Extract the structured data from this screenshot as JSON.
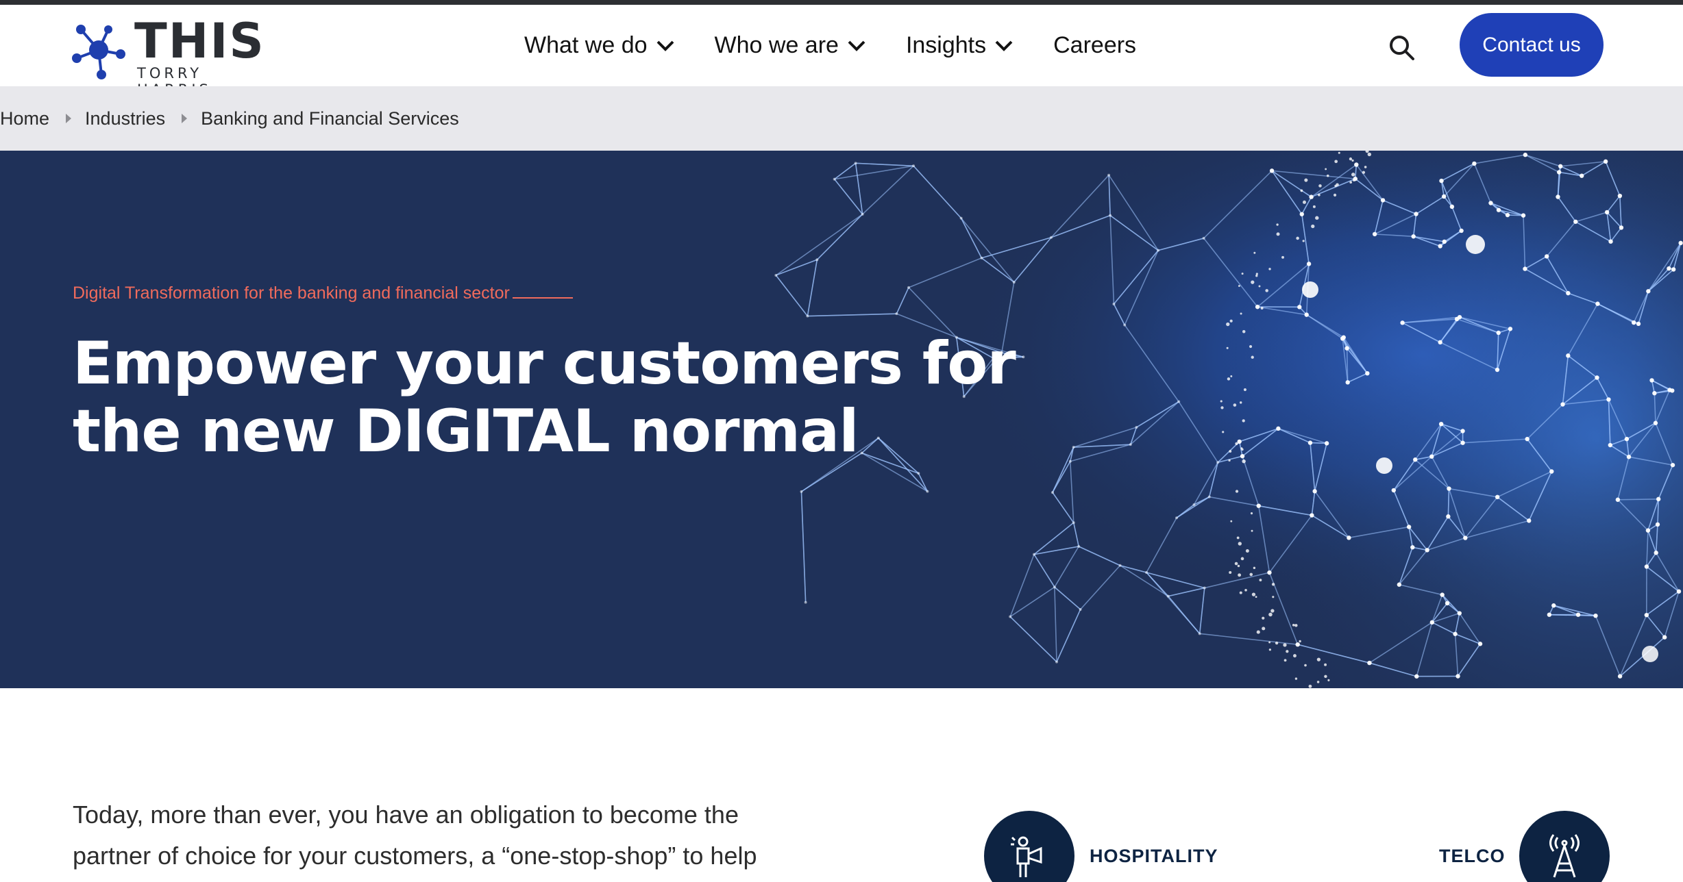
{
  "brand": {
    "logo_text": "THIS",
    "logo_sub": "TORRY HARRIS"
  },
  "nav": {
    "items": [
      {
        "label": "What we do",
        "has_dropdown": true
      },
      {
        "label": "Who we are",
        "has_dropdown": true
      },
      {
        "label": "Insights",
        "has_dropdown": true
      },
      {
        "label": "Careers",
        "has_dropdown": false
      }
    ],
    "search_icon": "search-icon",
    "contact_label": "Contact us"
  },
  "breadcrumb": [
    "Home",
    "Industries",
    "Banking and Financial Services"
  ],
  "hero": {
    "kicker": "Digital Transformation for the banking and financial sector",
    "title_line1": "Empower your customers for",
    "title_line2": "the new DIGITAL normal"
  },
  "intro": {
    "line1": "Today, more than ever, you have an obligation to become the",
    "line2": "partner of choice for your customers, a “one-stop-shop” to help"
  },
  "industries": [
    {
      "label": "HOSPITALITY",
      "icon": "hospitality-icon"
    },
    {
      "label": "TELCO",
      "icon": "telco-tower-icon"
    }
  ],
  "colors": {
    "accent": "#1f40b7",
    "hero_bg": "#1e3158",
    "kicker": "#f06b5c",
    "breadcrumb_bg": "#e8e8ec",
    "industry_circle": "#0d2342"
  }
}
